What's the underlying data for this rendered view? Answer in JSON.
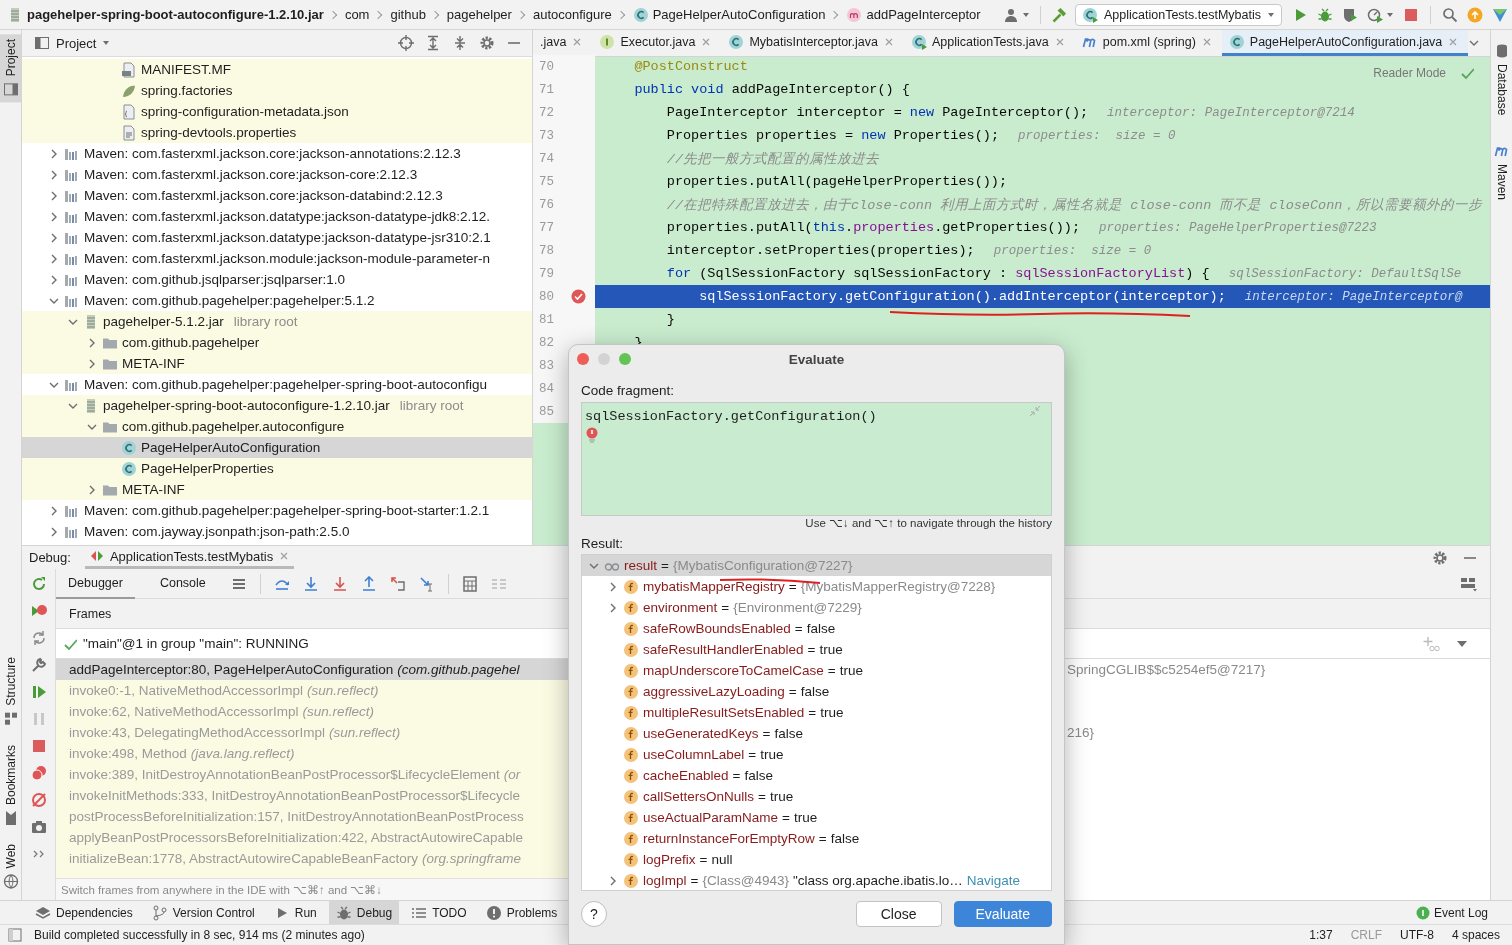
{
  "breadcrumbs": [
    {
      "text": "pagehelper-spring-boot-autoconfigure-1.2.10.jar",
      "kind": "jar"
    },
    {
      "text": "com",
      "kind": "package"
    },
    {
      "text": "github",
      "kind": "package"
    },
    {
      "text": "pagehelper",
      "kind": "package"
    },
    {
      "text": "autoconfigure",
      "kind": "package"
    },
    {
      "text": "PageHelperAutoConfiguration",
      "kind": "class"
    },
    {
      "text": "addPageInterceptor",
      "kind": "method"
    }
  ],
  "run_configuration": "ApplicationTests.testMybatis",
  "side_stripes": {
    "left": [
      {
        "label": "Project",
        "selected": true
      },
      {
        "label": "Structure",
        "selected": false
      },
      {
        "label": "Bookmarks",
        "selected": false
      },
      {
        "label": "Web",
        "selected": false
      }
    ],
    "right": [
      {
        "label": "Database",
        "selected": false
      },
      {
        "label": "Maven",
        "selected": false
      }
    ]
  },
  "project_panel": {
    "title": "Project"
  },
  "tree": {
    "continued_items": [
      {
        "label": "MANIFEST.MF",
        "kind": "manifest",
        "selected": false
      },
      {
        "label": "spring.factories",
        "kind": "spring",
        "selected": false
      },
      {
        "label": "spring-configuration-metadata.json",
        "kind": "json",
        "selected": false
      },
      {
        "label": "spring-devtools.properties",
        "kind": "properties",
        "selected": false
      }
    ],
    "items": [
      {
        "label": "Maven: com.fasterxml.jackson.core:jackson-annotations:2.12.3",
        "kind": "library",
        "expanded": false,
        "selected": false
      },
      {
        "label": "Maven: com.fasterxml.jackson.core:jackson-core:2.12.3",
        "kind": "library",
        "expanded": false,
        "selected": false
      },
      {
        "label": "Maven: com.fasterxml.jackson.core:jackson-databind:2.12.3",
        "kind": "library",
        "expanded": false,
        "selected": false
      },
      {
        "label": "Maven: com.fasterxml.jackson.datatype:jackson-datatype-jdk8:2.12.",
        "kind": "library",
        "expanded": false,
        "selected": false
      },
      {
        "label": "Maven: com.fasterxml.jackson.datatype:jackson-datatype-jsr310:2.1",
        "kind": "library",
        "expanded": false,
        "selected": false
      },
      {
        "label": "Maven: com.fasterxml.jackson.module:jackson-module-parameter-n",
        "kind": "library",
        "expanded": false,
        "selected": false
      },
      {
        "label": "Maven: com.github.jsqlparser:jsqlparser:1.0",
        "kind": "library",
        "expanded": false,
        "selected": false
      },
      {
        "label": "Maven: com.github.pagehelper:pagehelper:5.1.2",
        "kind": "library",
        "expanded": true,
        "selected": false,
        "children": [
          {
            "label": "pagehelper-5.1.2.jar",
            "suffix": "library root",
            "kind": "jar",
            "expanded": true,
            "selected": false,
            "children": [
              {
                "label": "com.github.pagehelper",
                "kind": "folder",
                "expanded": false,
                "selected": false
              },
              {
                "label": "META-INF",
                "kind": "folder",
                "expanded": false,
                "selected": false
              }
            ]
          }
        ]
      },
      {
        "label": "Maven: com.github.pagehelper:pagehelper-spring-boot-autoconfigu",
        "kind": "library",
        "expanded": true,
        "selected": false,
        "children": [
          {
            "label": "pagehelper-spring-boot-autoconfigure-1.2.10.jar",
            "suffix": "library root",
            "kind": "jar",
            "expanded": true,
            "selected": false,
            "children": [
              {
                "label": "com.github.pagehelper.autoconfigure",
                "kind": "folder",
                "expanded": true,
                "selected": false,
                "children": [
                  {
                    "label": "PageHelperAutoConfiguration",
                    "kind": "class",
                    "selected": true
                  },
                  {
                    "label": "PageHelperProperties",
                    "kind": "class",
                    "selected": false
                  }
                ]
              },
              {
                "label": "META-INF",
                "kind": "folder",
                "expanded": false,
                "selected": false
              }
            ]
          }
        ]
      },
      {
        "label": "Maven: com.github.pagehelper:pagehelper-spring-boot-starter:1.2.1",
        "kind": "library",
        "expanded": false,
        "selected": false
      },
      {
        "label": "Maven: com.jayway.jsonpath:json-path:2.5.0",
        "kind": "library",
        "expanded": false,
        "selected": false
      }
    ]
  },
  "editor_tabs": [
    {
      "label": ".java",
      "kind": "java",
      "selected": false
    },
    {
      "label": "Executor.java",
      "kind": "interface",
      "selected": false
    },
    {
      "label": "MybatisInterceptor.java",
      "kind": "class",
      "selected": false
    },
    {
      "label": "ApplicationTests.java",
      "kind": "test-class",
      "selected": false
    },
    {
      "label": "pom.xml (spring)",
      "kind": "maven",
      "selected": false
    },
    {
      "label": "PageHelperAutoConfiguration.java",
      "kind": "class",
      "selected": true
    }
  ],
  "editor": {
    "reader_mode": "Reader Mode",
    "lines": [
      {
        "number": "70",
        "segments": [
          {
            "text": "    @PostConstruct",
            "kind": "annotation"
          }
        ],
        "breakpoint": false,
        "current": false
      },
      {
        "number": "71",
        "segments": [
          {
            "text": "    public void",
            "kind": "keyword"
          },
          {
            "text": " addPageInterceptor() {",
            "kind": "plain"
          }
        ],
        "breakpoint": false,
        "current": false
      },
      {
        "number": "72",
        "segments": [
          {
            "text": "        PageInterceptor interceptor = ",
            "kind": "plain"
          },
          {
            "text": "new",
            "kind": "keyword"
          },
          {
            "text": " PageInterceptor();",
            "kind": "plain"
          }
        ],
        "hint": "interceptor: PageInterceptor@7214",
        "breakpoint": false,
        "current": false
      },
      {
        "number": "73",
        "segments": [
          {
            "text": "        Properties properties = ",
            "kind": "plain"
          },
          {
            "text": "new",
            "kind": "keyword"
          },
          {
            "text": " Properties();",
            "kind": "plain"
          }
        ],
        "hint": "properties:  size = 0",
        "breakpoint": false,
        "current": false
      },
      {
        "number": "74",
        "segments": [
          {
            "text": "        //先把一般方式配置的属性放进去",
            "kind": "comment"
          }
        ],
        "breakpoint": false,
        "current": false
      },
      {
        "number": "75",
        "segments": [
          {
            "text": "        properties.putAll(pageHelperProperties());",
            "kind": "plain"
          }
        ],
        "breakpoint": false,
        "current": false
      },
      {
        "number": "76",
        "segments": [
          {
            "text": "        //在把特殊配置放进去，由于close-conn 利用上面方式时，属性名就是 close-conn 而不是 closeConn，所以需要额外的一步",
            "kind": "comment"
          }
        ],
        "breakpoint": false,
        "current": false
      },
      {
        "number": "77",
        "segments": [
          {
            "text": "        properties.putAll(",
            "kind": "plain"
          },
          {
            "text": "this",
            "kind": "keyword"
          },
          {
            "text": ".",
            "kind": "plain"
          },
          {
            "text": "properties",
            "kind": "field"
          },
          {
            "text": ".getProperties());",
            "kind": "plain"
          }
        ],
        "hint": "properties: PageHelperProperties@7223",
        "breakpoint": false,
        "current": false
      },
      {
        "number": "78",
        "segments": [
          {
            "text": "        interceptor.setProperties(properties);",
            "kind": "plain"
          }
        ],
        "hint": "properties:  size = 0",
        "breakpoint": false,
        "current": false
      },
      {
        "number": "79",
        "segments": [
          {
            "text": "        for",
            "kind": "keyword"
          },
          {
            "text": " (SqlSessionFactory sqlSessionFactory : ",
            "kind": "plain"
          },
          {
            "text": "sqlSessionFactoryList",
            "kind": "field"
          },
          {
            "text": ") {",
            "kind": "plain"
          }
        ],
        "hint": "sqlSessionFactory: DefaultSqlSe",
        "breakpoint": false,
        "current": false
      },
      {
        "number": "80",
        "segments": [
          {
            "text": "            sqlSessionFactory.getConfiguration().addInterceptor(interceptor);",
            "kind": "plain"
          }
        ],
        "hint": "interceptor: PageInterceptor@",
        "breakpoint": true,
        "current": true
      },
      {
        "number": "81",
        "segments": [
          {
            "text": "        }",
            "kind": "plain"
          }
        ],
        "breakpoint": false,
        "current": false
      },
      {
        "number": "82",
        "segments": [
          {
            "text": "    }",
            "kind": "plain"
          }
        ],
        "breakpoint": false,
        "current": false
      },
      {
        "number": "83"
      },
      {
        "number": "84"
      },
      {
        "number": "85"
      }
    ]
  },
  "debug": {
    "label": "Debug:",
    "session_tab": "ApplicationTests.testMybatis",
    "tabs": [
      {
        "label": "Debugger",
        "selected": true
      },
      {
        "label": "Console",
        "selected": false
      }
    ],
    "frames_title": "Frames",
    "thread": "\"main\"@1 in group \"main\": RUNNING",
    "frames": [
      {
        "location": "addPageInterceptor:80, PageHelperAutoConfiguration",
        "package": "(com.github.pagehel",
        "library": false,
        "selected": true
      },
      {
        "location": "invoke0:-1, NativeMethodAccessorImpl",
        "package": "(sun.reflect)",
        "library": true,
        "selected": false
      },
      {
        "location": "invoke:62, NativeMethodAccessorImpl",
        "package": "(sun.reflect)",
        "library": true,
        "selected": false
      },
      {
        "location": "invoke:43, DelegatingMethodAccessorImpl",
        "package": "(sun.reflect)",
        "library": true,
        "selected": false
      },
      {
        "location": "invoke:498, Method",
        "package": "(java.lang.reflect)",
        "library": true,
        "selected": false
      },
      {
        "location": "invoke:389, InitDestroyAnnotationBeanPostProcessor$LifecycleElement",
        "package": "(or",
        "library": true,
        "selected": false
      },
      {
        "location": "invokeInitMethods:333, InitDestroyAnnotationBeanPostProcessor$Lifecycle",
        "library": true,
        "selected": false
      },
      {
        "location": "postProcessBeforeInitialization:157, InitDestroyAnnotationBeanPostProcess",
        "library": true,
        "selected": false
      },
      {
        "location": "applyBeanPostProcessorsBeforeInitialization:422, AbstractAutowireCapable",
        "library": true,
        "selected": false
      },
      {
        "location": "initializeBean:1778, AbstractAutowireCapableBeanFactory",
        "package": "(org.springframe",
        "library": true,
        "selected": false
      }
    ],
    "frames_hint": "Switch frames from anywhere in the IDE with ⌥⌘↑ and ⌥⌘↓",
    "variables": [
      {
        "text": "SpringCGLIB$$c5254ef5@7217}"
      },
      {
        "text": "216}"
      }
    ]
  },
  "evaluate": {
    "title": "Evaluate",
    "code_label": "Code fragment:",
    "code": "sqlSessionFactory.getConfiguration()",
    "history_hint": "Use ⌥↓ and ⌥↑ to navigate through the history",
    "result_label": "Result:",
    "separator": "=",
    "result": {
      "name": "result",
      "value": "{MybatisConfiguration@7227}",
      "kind": "object",
      "expanded": true,
      "selected": true,
      "children": [
        {
          "name": "mybatisMapperRegistry",
          "value": "{MybatisMapperRegistry@7228}",
          "kind": "object",
          "expanded": false,
          "selected": false
        },
        {
          "name": "environment",
          "value": "{Environment@7229}",
          "kind": "object",
          "expanded": false,
          "selected": false
        },
        {
          "name": "safeRowBoundsEnabled",
          "value": "false",
          "kind": "primitive",
          "selected": false
        },
        {
          "name": "safeResultHandlerEnabled",
          "value": "true",
          "kind": "primitive",
          "selected": false
        },
        {
          "name": "mapUnderscoreToCamelCase",
          "value": "true",
          "kind": "primitive",
          "selected": false
        },
        {
          "name": "aggressiveLazyLoading",
          "value": "false",
          "kind": "primitive",
          "selected": false
        },
        {
          "name": "multipleResultSetsEnabled",
          "value": "true",
          "kind": "primitive",
          "selected": false
        },
        {
          "name": "useGeneratedKeys",
          "value": "false",
          "kind": "primitive",
          "selected": false
        },
        {
          "name": "useColumnLabel",
          "value": "true",
          "kind": "primitive",
          "selected": false
        },
        {
          "name": "cacheEnabled",
          "value": "false",
          "kind": "primitive",
          "selected": false
        },
        {
          "name": "callSettersOnNulls",
          "value": "true",
          "kind": "primitive",
          "selected": false
        },
        {
          "name": "useActualParamName",
          "value": "true",
          "kind": "primitive",
          "selected": false
        },
        {
          "name": "returnInstanceForEmptyRow",
          "value": "false",
          "kind": "primitive",
          "selected": false
        },
        {
          "name": "logPrefix",
          "value": "null",
          "kind": "primitive",
          "selected": false
        },
        {
          "name": "logImpl",
          "value": "{Class@4943}",
          "kind": "object",
          "extra": "\"class org.apache.ibatis.lo…",
          "link": "Navigate",
          "expanded": false,
          "selected": false
        }
      ]
    },
    "help_button": "?",
    "buttons": [
      {
        "label": "Close",
        "default": false
      },
      {
        "label": "Evaluate",
        "default": true
      }
    ]
  },
  "tool_windows": [
    {
      "label": "Dependencies",
      "kind": "layers",
      "selected": false
    },
    {
      "label": "Version Control",
      "kind": "vcs",
      "selected": false
    },
    {
      "label": "Run",
      "kind": "run",
      "selected": false
    },
    {
      "label": "Debug",
      "kind": "debug",
      "selected": true
    },
    {
      "label": "TODO",
      "kind": "list",
      "selected": false
    },
    {
      "label": "Problems",
      "kind": "problems",
      "selected": false
    }
  ],
  "event_log": "Event Log",
  "status": {
    "message": "Build completed successfully in 8 sec, 914 ms (2 minutes ago)",
    "position": "1:37",
    "line_separator": "CRLF",
    "encoding": "UTF-8",
    "indent": "4 spaces"
  }
}
